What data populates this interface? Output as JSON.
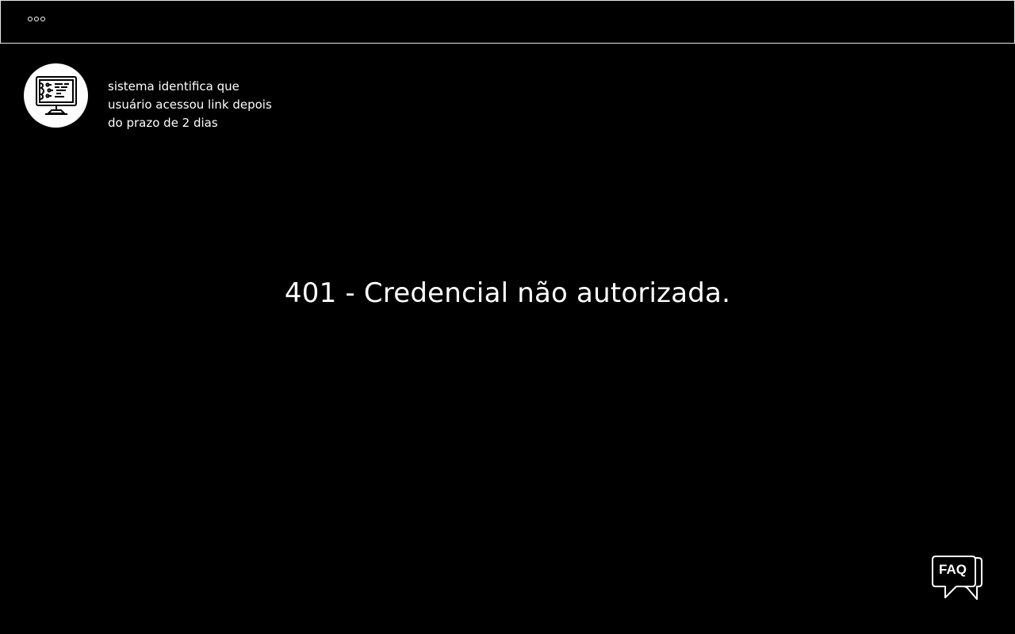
{
  "topbar": {
    "icon": "window-dots-icon"
  },
  "note": {
    "icon": "monitor-code-icon",
    "lines": [
      "sistema identifica que",
      "usuário acessou link depois",
      "do prazo de 2 dias"
    ]
  },
  "main": {
    "error_message": "401 - Credencial não autorizada."
  },
  "faq": {
    "label": "FAQ",
    "icon": "chat-bubbles-icon"
  },
  "colors": {
    "background": "#000000",
    "foreground": "#ffffff"
  }
}
